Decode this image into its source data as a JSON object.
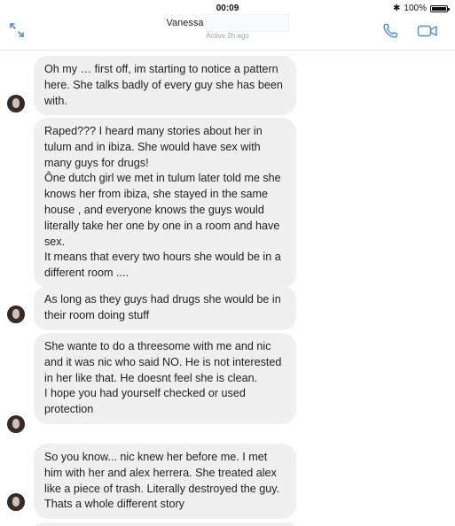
{
  "status_bar": {
    "time": "00:09",
    "bluetooth_icon": "bluetooth-icon",
    "battery_text": "100%",
    "battery_level": 1.0
  },
  "header": {
    "contact_name": "Vanessa",
    "contact_status": "Active 2h ago",
    "expand_icon": "expand-arrows-icon",
    "call_icon": "phone-icon",
    "video_icon": "video-camera-icon",
    "accent_color": "#4b8ed6"
  },
  "messages": [
    {
      "text": "Oh my … first off, im starting to notice a pattern here. She talks badly of every guy she has been with."
    },
    {
      "text": "Raped??? I heard many stories about her in tulum and in ibiza. She would have sex with many guys for drugs!\nÔne dutch girl we met in tulum later told me she knows her from ibiza, she stayed in the same house , and everyone knows the guys would literally take her one by one in a room and have sex.\nIt means that every two hours she would be in a different room ...."
    },
    {
      "text": "As long as they guys had drugs she would be in their room doing stuff"
    },
    {
      "text": "She wante to do a threesome with me and nic and it was nic who said NO. He is not interested in her like that. He doesnt feel she is clean.\nI hope you had yourself checked or used protection"
    },
    {
      "text": "So you know... nic knew her before me. I met him with her and alex herrera. She treated alex like a piece of trash. Literally destroyed the guy. Thats a whole different story"
    }
  ],
  "colors": {
    "bubble_background": "#f1f0f0",
    "message_text": "#1c1e21",
    "header_divider": "#e2e6ea"
  }
}
